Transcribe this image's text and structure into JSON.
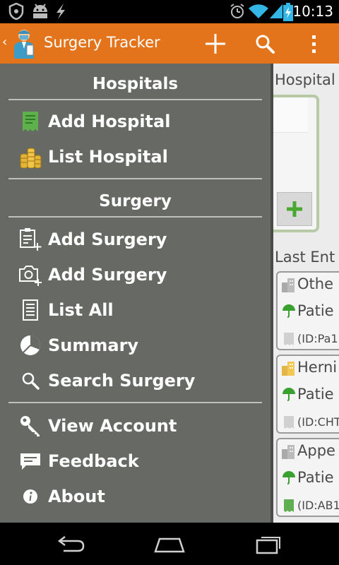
{
  "status_bar": {
    "time": "10:13",
    "icons": [
      "shield-icon",
      "android-icon",
      "bolt-icon",
      "alarm-icon",
      "wifi-icon",
      "signal-icon",
      "battery-charging-icon"
    ]
  },
  "action_bar": {
    "title": "Surgery Tracker",
    "actions": [
      "add-icon",
      "search-icon",
      "overflow-menu-icon"
    ],
    "color": "#e4741b"
  },
  "drawer": {
    "background": "#676964",
    "sections": [
      {
        "header": "Hospitals",
        "items": [
          {
            "label": "Add Hospital",
            "icon": "receipt-icon"
          },
          {
            "label": "List Hospital",
            "icon": "coins-icon"
          }
        ]
      },
      {
        "header": "Surgery",
        "items": [
          {
            "label": "Add Surgery",
            "icon": "clipboard-add-icon"
          },
          {
            "label": "Add Surgery",
            "icon": "camera-add-icon"
          },
          {
            "label": "List All",
            "icon": "list-icon"
          },
          {
            "label": "Summary",
            "icon": "pie-chart-icon"
          },
          {
            "label": "Search Surgery",
            "icon": "search-icon"
          }
        ]
      },
      {
        "header": "",
        "items": [
          {
            "label": "View Account",
            "icon": "key-icon"
          },
          {
            "label": "Feedback",
            "icon": "feedback-icon"
          },
          {
            "label": "About",
            "icon": "info-icon"
          }
        ]
      }
    ]
  },
  "content": {
    "hospitals_title": "Hospital",
    "last_entries_title": "Last Ent",
    "entries": [
      {
        "name": "Othe",
        "patient": "Patie",
        "id": "(ID:Pa1"
      },
      {
        "name": "Herni",
        "patient": "Patie",
        "id": "(ID:CHT"
      },
      {
        "name": "Appe",
        "patient": "Patie",
        "id": "(ID:AB1"
      }
    ]
  },
  "nav_bar": {
    "buttons": [
      "back-icon",
      "home-icon",
      "recent-apps-icon"
    ]
  }
}
